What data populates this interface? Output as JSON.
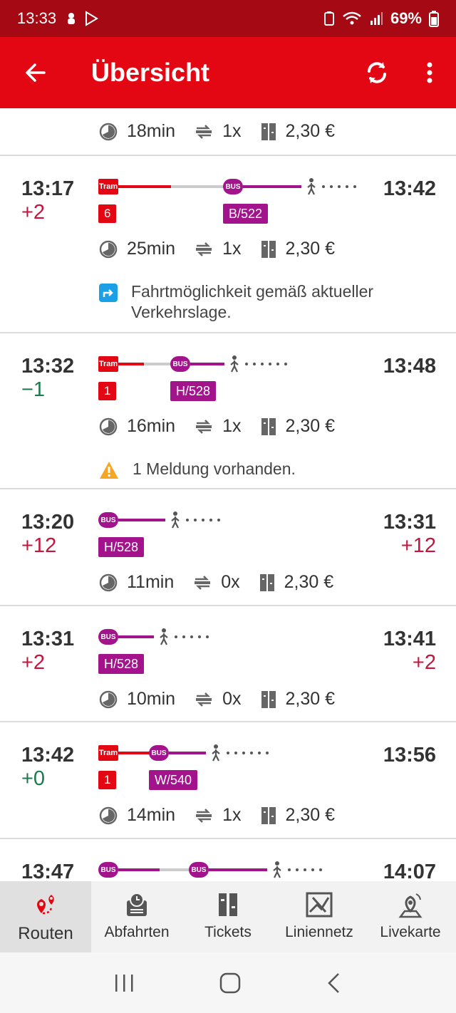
{
  "status_bar": {
    "time": "13:33",
    "battery": "69%"
  },
  "app_bar": {
    "title": "Übersicht"
  },
  "routes": [
    {
      "duration": "18min",
      "changes": "1x",
      "price": "2,30 €"
    },
    {
      "dep_time": "13:17",
      "dep_delay": "+2",
      "arr_time": "13:42",
      "arr_delay": "",
      "legs": [
        "Tram 6",
        "BUS B/522"
      ],
      "labels": [
        "6",
        "B/522"
      ],
      "duration": "25min",
      "changes": "1x",
      "price": "2,30 €",
      "note": "Fahrtmöglichkeit gemäß aktueller Verkehrslage."
    },
    {
      "dep_time": "13:32",
      "dep_delay": "−1",
      "arr_time": "13:48",
      "arr_delay": "",
      "labels": [
        "1",
        "H/528"
      ],
      "duration": "16min",
      "changes": "1x",
      "price": "2,30 €",
      "note": "1 Meldung vorhanden."
    },
    {
      "dep_time": "13:20",
      "dep_delay": "+12",
      "arr_time": "13:31",
      "arr_delay": "+12",
      "labels": [
        "H/528"
      ],
      "duration": "11min",
      "changes": "0x",
      "price": "2,30 €"
    },
    {
      "dep_time": "13:31",
      "dep_delay": "+2",
      "arr_time": "13:41",
      "arr_delay": "+2",
      "labels": [
        "H/528"
      ],
      "duration": "10min",
      "changes": "0x",
      "price": "2,30 €"
    },
    {
      "dep_time": "13:42",
      "dep_delay": "+0",
      "arr_time": "13:56",
      "arr_delay": "",
      "labels": [
        "1",
        "W/540"
      ],
      "duration": "14min",
      "changes": "1x",
      "price": "2,30 €"
    },
    {
      "dep_time": "13:47",
      "arr_time": "14:07"
    }
  ],
  "badges": {
    "tram": "Tram",
    "bus": "BUS"
  },
  "bottom_nav": [
    {
      "label": "Routen",
      "icon": "route-pin-icon"
    },
    {
      "label": "Abfahrten",
      "icon": "departures-clock-icon"
    },
    {
      "label": "Tickets",
      "icon": "ticket-icon"
    },
    {
      "label": "Liniennetz",
      "icon": "network-map-icon"
    },
    {
      "label": "Livekarte",
      "icon": "live-map-pin-icon"
    }
  ],
  "colors": {
    "brand": "#e30613",
    "status_bar": "#a50a14",
    "bus": "#a3148c",
    "late": "#c4163d",
    "early": "#1f7a4d"
  }
}
